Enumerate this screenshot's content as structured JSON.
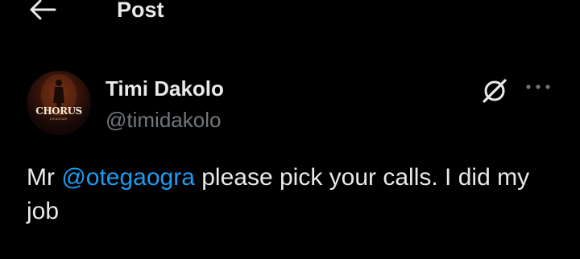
{
  "header": {
    "title": "Post",
    "back_icon": "arrow-left-icon"
  },
  "author": {
    "display_name": "Timi Dakolo",
    "handle": "@timidakolo",
    "avatar_logo_text": "CHORUS",
    "avatar_sub_text": "LEAGUE"
  },
  "actions": {
    "grok_icon": "grok-icon",
    "more_icon": "more-horizontal-icon"
  },
  "post": {
    "text_before": "Mr ",
    "mention": "@otegaogra",
    "text_after": " please pick your calls. I did my job"
  },
  "colors": {
    "background": "#000000",
    "text": "#e7e9ea",
    "secondary": "#71767b",
    "accent": "#1d9bf0"
  }
}
